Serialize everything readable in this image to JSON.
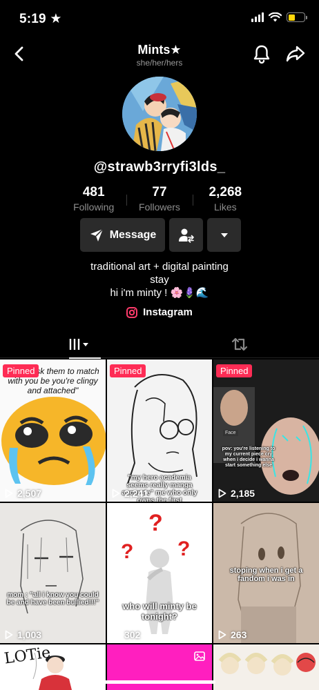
{
  "status_bar": {
    "time": "5:19"
  },
  "nav": {
    "title": "Mints★",
    "pronouns": "she/her/hers"
  },
  "profile": {
    "username": "@strawb3rryfi3lds_",
    "stats": [
      {
        "value": "481",
        "label": "Following"
      },
      {
        "value": "77",
        "label": "Followers"
      },
      {
        "value": "2,268",
        "label": "Likes"
      }
    ],
    "message_label": "Message",
    "bio_lines": [
      "traditional art + digital painting",
      "stay",
      "hi i'm minty ! 🌸🪻🌊"
    ],
    "instagram_label": "Instagram"
  },
  "grid": {
    "pinned_label": "Pinned",
    "videos": [
      {
        "views": "2,507",
        "pinned": true,
        "caption": "\"...just ask them to match with you be you're clingy and attached\""
      },
      {
        "views": "2,241",
        "pinned": true,
        "caption": "\"my hero academia seems really manga accurate\" me who only owns the first"
      },
      {
        "views": "2,185",
        "pinned": true,
        "caption": "pov: you're listening to my current piece cry when i decide i wanna start something else",
        "overlay_label": "Face"
      },
      {
        "views": "1,003",
        "pinned": false,
        "caption": "mom : \"all i know you could be and have been bullied!!!\""
      },
      {
        "views": "302",
        "pinned": false,
        "caption": "who will minty be tonight?"
      },
      {
        "views": "263",
        "pinned": false,
        "caption": "stoping when i get a fandom i was in"
      },
      {
        "views": "",
        "pinned": false,
        "caption": "",
        "label": "LOTie"
      },
      {
        "views": "",
        "pinned": false,
        "caption": ""
      },
      {
        "views": "",
        "pinned": false,
        "caption": ""
      }
    ]
  },
  "colors": {
    "background": "#000000",
    "button": "#2b2b2b",
    "pinned": "#fe2c55",
    "battery": "#ffd60a"
  }
}
